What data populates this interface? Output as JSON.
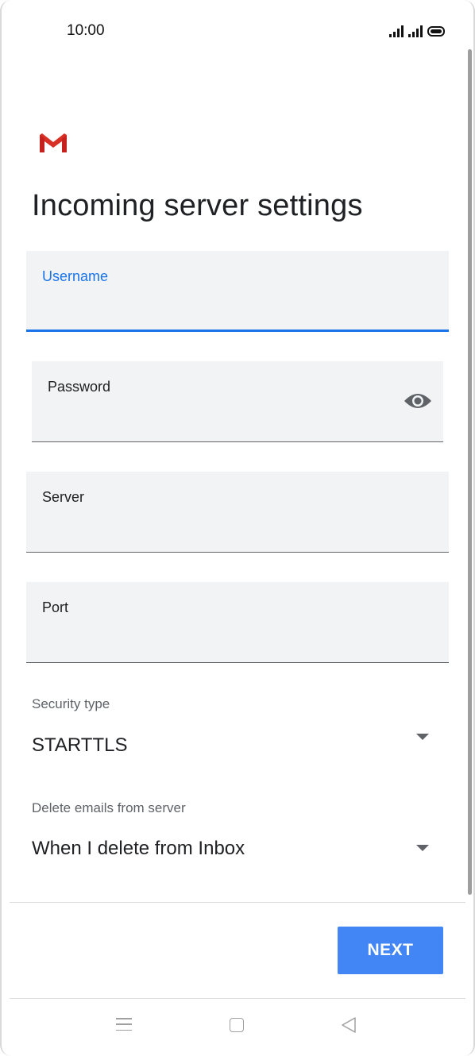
{
  "status_bar": {
    "time": "10:00"
  },
  "app": {
    "logo": "gmail-logo",
    "title": "Incoming server settings"
  },
  "form": {
    "username": {
      "label": "Username",
      "value": ""
    },
    "password": {
      "label": "Password",
      "value": "",
      "toggle_icon": "eye-icon"
    },
    "server": {
      "label": "Server",
      "value": ""
    },
    "port": {
      "label": "Port",
      "value": ""
    },
    "security_type": {
      "label": "Security type",
      "value": "STARTTLS"
    },
    "delete_emails": {
      "label": "Delete emails from server",
      "value": "When I delete from Inbox"
    }
  },
  "actions": {
    "next_label": "NEXT"
  },
  "colors": {
    "accent": "#1a73e8",
    "button": "#4285f4",
    "field_bg": "#f1f3f4",
    "gmail_red": "#d93025"
  },
  "nav_bar": {
    "icons": [
      "menu-icon",
      "home-icon",
      "back-icon"
    ]
  }
}
